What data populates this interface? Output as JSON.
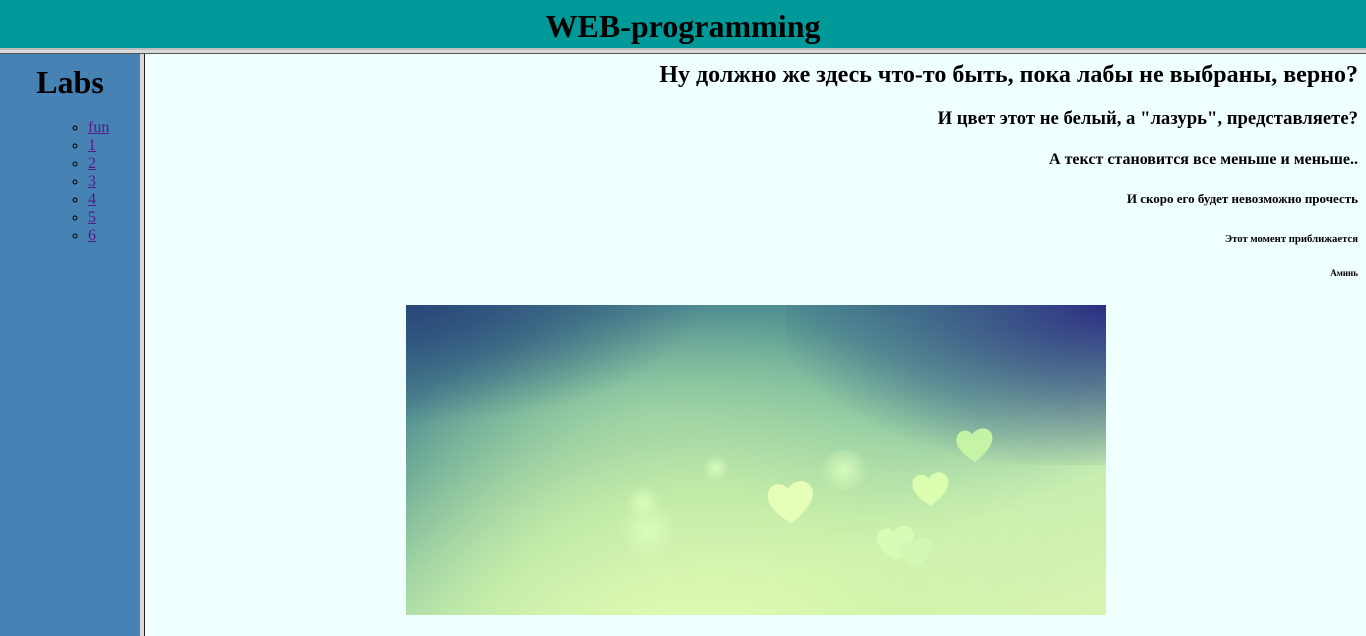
{
  "header": {
    "title": "WEB-programming"
  },
  "sidebar": {
    "title": "Labs",
    "items": [
      {
        "label": "fun"
      },
      {
        "label": "1"
      },
      {
        "label": "2"
      },
      {
        "label": "3"
      },
      {
        "label": "4"
      },
      {
        "label": "5"
      },
      {
        "label": "6"
      }
    ]
  },
  "main": {
    "lines": [
      "Ну должно же здесь что-то быть, пока лабы не выбраны, верно?",
      "И цвет этот не белый, а \"лазурь\", представляете?",
      "А текст становится все меньше и меньше..",
      "И скоро его будет невозможно прочесть",
      "Этот момент приближается",
      "Аминь"
    ]
  },
  "colors": {
    "header_bg": "#009999",
    "sidebar_bg": "#4682b4",
    "page_bg": "#f0ffff",
    "link": "#551a8b"
  }
}
